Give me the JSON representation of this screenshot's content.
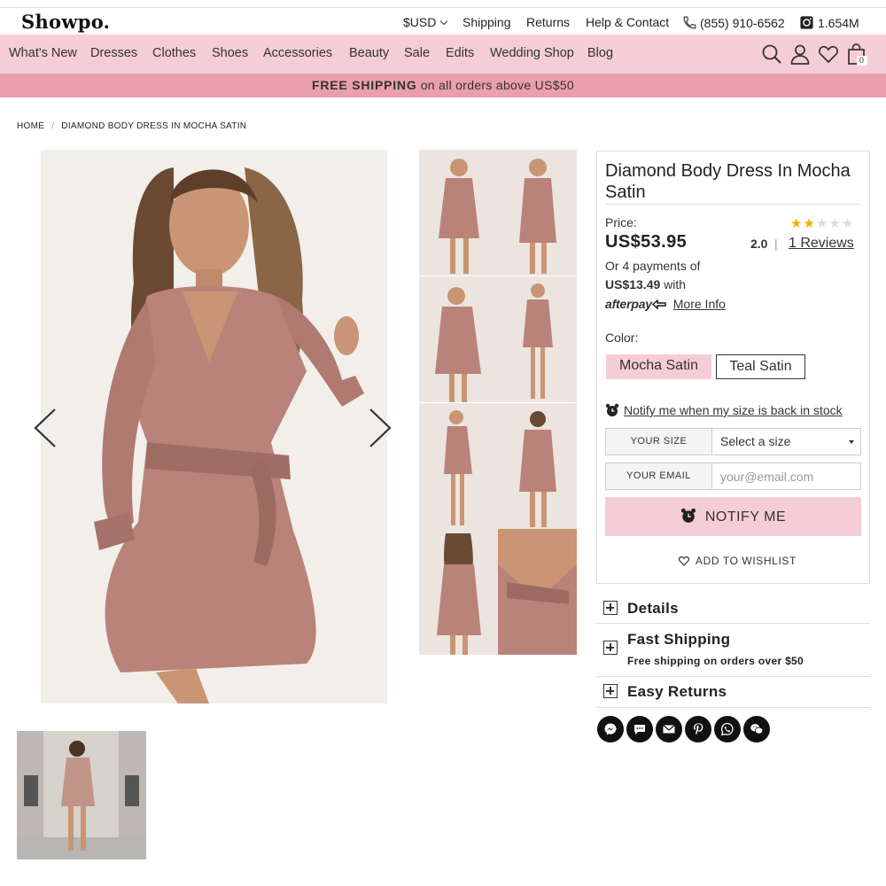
{
  "header": {
    "logo": "Showpo.",
    "currency": "$USD",
    "shipping": "Shipping",
    "returns": "Returns",
    "help": "Help & Contact",
    "phone": "(855) 910-6562",
    "instagram": "1.654M"
  },
  "nav": {
    "items": [
      "What's New",
      "Dresses",
      "Clothes",
      "Shoes",
      "Accessories",
      "Beauty",
      "Sale",
      "Edits",
      "Wedding Shop",
      "Blog"
    ],
    "cart_count": "0",
    "icons": [
      "search-icon",
      "account-icon",
      "heart-icon",
      "bag-icon"
    ]
  },
  "banner": {
    "bold": "FREE SHIPPING",
    "text": " on all orders above US$50"
  },
  "breadcrumb": {
    "home": "HOME",
    "sep": "/",
    "current": "DIAMOND BODY DRESS IN MOCHA SATIN"
  },
  "product": {
    "title": "Diamond Body Dress In Mocha Satin",
    "price_label": "Price:",
    "price": "US$53.95",
    "rating": 2.0,
    "rating_text": "2.0",
    "rating_sep": "|",
    "reviews": "1 Reviews",
    "payments_line1": "Or 4 payments of",
    "installment": "US$13.49",
    "with": "with",
    "afterpay": "afterpay",
    "more_info": "More Info",
    "color_label": "Color:",
    "colors": [
      {
        "label": "Mocha Satin",
        "selected": true
      },
      {
        "label": "Teal Satin",
        "selected": false
      }
    ],
    "notify_text": "Notify me when my size is back in stock",
    "size_label": "YOUR SIZE",
    "size_select": "Select a size",
    "email_label": "YOUR EMAIL",
    "email_placeholder": "your@email.com",
    "notify_button": "NOTIFY ME",
    "wishlist": "ADD TO WISHLIST"
  },
  "accordion": {
    "details": "Details",
    "fast_shipping": "Fast Shipping",
    "fast_shipping_sub": "Free shipping on orders over $50",
    "easy_returns": "Easy Returns"
  },
  "share": [
    "messenger-icon",
    "sms-icon",
    "email-icon",
    "pinterest-icon",
    "whatsapp-icon",
    "wechat-icon"
  ],
  "colors": {
    "nav_pink": "#f5cdd6",
    "banner_pink": "#eb9fac",
    "dress": "#b9837a",
    "star": "#f0b000"
  }
}
